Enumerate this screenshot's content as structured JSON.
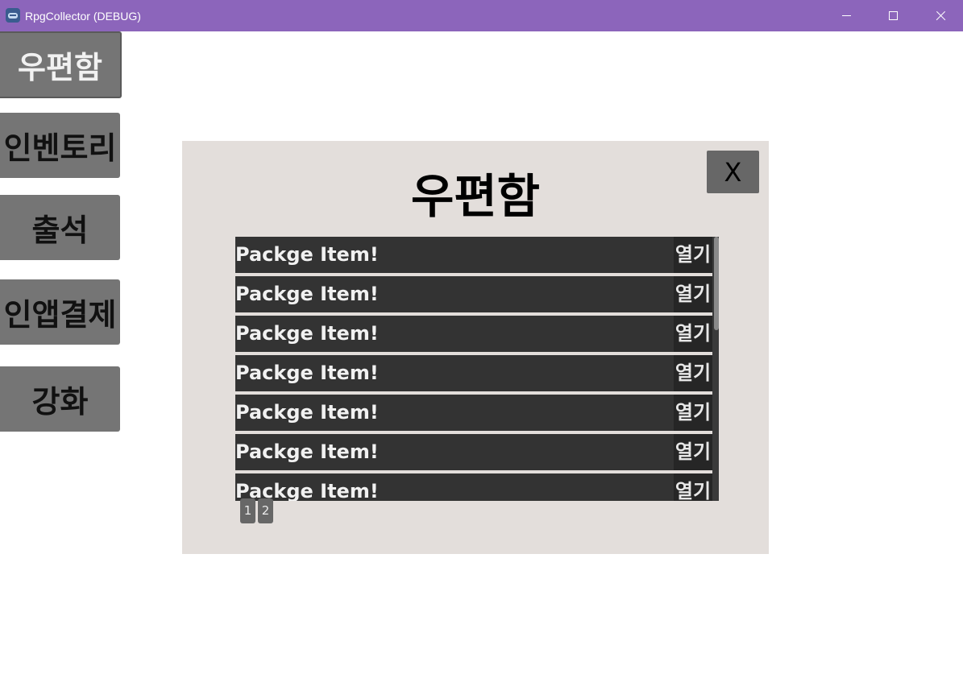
{
  "window": {
    "title": "RpgCollector (DEBUG)"
  },
  "menu": {
    "items": [
      {
        "label": "우편함",
        "active": true
      },
      {
        "label": "인벤토리",
        "active": false
      },
      {
        "label": "출석",
        "active": false
      },
      {
        "label": "인앱결제",
        "active": false
      },
      {
        "label": "강화",
        "active": false
      }
    ]
  },
  "mailbox": {
    "title": "우편함",
    "close_label": "X",
    "items": [
      {
        "text": "Packge Item!",
        "action": "열기"
      },
      {
        "text": "Packge Item!",
        "action": "열기"
      },
      {
        "text": "Packge Item!",
        "action": "열기"
      },
      {
        "text": "Packge Item!",
        "action": "열기"
      },
      {
        "text": "Packge Item!",
        "action": "열기"
      },
      {
        "text": "Packge Item!",
        "action": "열기"
      },
      {
        "text": "Packge Item!",
        "action": "열기"
      }
    ],
    "pages": [
      "1",
      "2"
    ]
  },
  "colors": {
    "titlebar": "#8c65bb",
    "menu_button": "#757575",
    "panel": "#e3dedb",
    "list_item": "#333333"
  }
}
